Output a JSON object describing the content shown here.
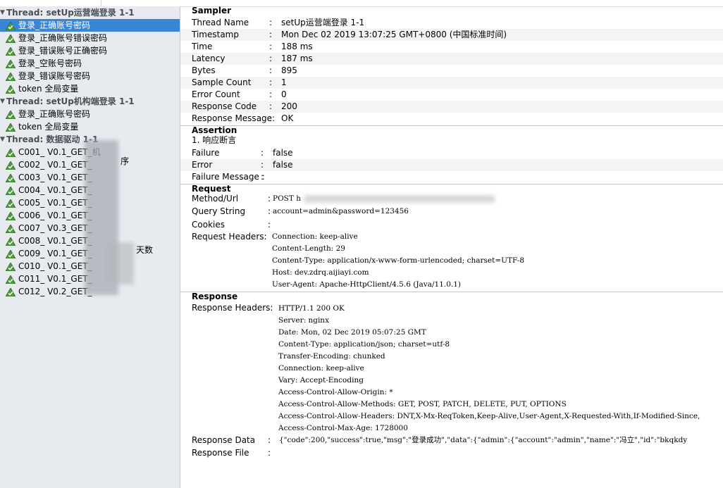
{
  "tree": {
    "items": [
      {
        "kind": "thread",
        "label": "Thread: setUp运营端登录 1-1"
      },
      {
        "kind": "sample",
        "label": "登录_正确账号密码",
        "selected": true
      },
      {
        "kind": "sample",
        "label": "登录_正确账号错误密码"
      },
      {
        "kind": "sample",
        "label": "登录_错误账号正确密码"
      },
      {
        "kind": "sample",
        "label": "登录_空账号密码"
      },
      {
        "kind": "sample",
        "label": "登录_错误账号密码"
      },
      {
        "kind": "sample",
        "label": "token 全局变量"
      },
      {
        "kind": "thread",
        "label": "Thread: setUp机构端登录 1-1"
      },
      {
        "kind": "sample",
        "label": "登录_正确账号密码"
      },
      {
        "kind": "sample",
        "label": "token 全局变量"
      },
      {
        "kind": "thread",
        "label": "Thread: 数据驱动 1-1"
      },
      {
        "kind": "sample",
        "label": "C001_ V0.1_GET_机"
      },
      {
        "kind": "sample",
        "label": "C002_ V0.1_GET_"
      },
      {
        "kind": "sample",
        "label": "C003_ V0.1_GET_"
      },
      {
        "kind": "sample",
        "label": "C004_ V0.1_GET_"
      },
      {
        "kind": "sample",
        "label": "C005_ V0.1_GET_"
      },
      {
        "kind": "sample",
        "label": "C006_ V0.1_GET_"
      },
      {
        "kind": "sample",
        "label": "C007_ V0.3_GET_"
      },
      {
        "kind": "sample",
        "label": "C008_ V0.1_GET_"
      },
      {
        "kind": "sample",
        "label": "C009_ V0.1_GET_"
      },
      {
        "kind": "sample",
        "label": "C010_ V0.1_GET_"
      },
      {
        "kind": "sample",
        "label": "C011_ V0.1_GET_"
      },
      {
        "kind": "sample",
        "label": "C012_ V0.2_GET_"
      }
    ],
    "c009_suffix": "天数",
    "c002_suffix": "序"
  },
  "sampler": {
    "title": "Sampler",
    "rows": [
      {
        "label": "Thread Name",
        "value": "setUp运营端登录 1-1"
      },
      {
        "label": "Timestamp",
        "value": "Mon Dec 02 2019 13:07:25 GMT+0800 (中国标准时间)"
      },
      {
        "label": "Time",
        "value": "188 ms"
      },
      {
        "label": "Latency",
        "value": "187 ms"
      },
      {
        "label": "Bytes",
        "value": "895"
      },
      {
        "label": "Sample Count",
        "value": "1"
      },
      {
        "label": "Error Count",
        "value": "0"
      },
      {
        "label": "Response Code",
        "value": "200"
      },
      {
        "label": "Response Message:",
        "value": "OK"
      }
    ]
  },
  "assertion": {
    "title": "Assertion",
    "name": "1. 响应断言",
    "rows": [
      {
        "label": "Failure",
        "value": "false"
      },
      {
        "label": "Error",
        "value": "false"
      },
      {
        "label": "Failure Message :",
        "value": ""
      }
    ]
  },
  "request": {
    "title": "Request",
    "method_label": "Method/Url",
    "method_value": "POST h",
    "query_label": "Query String",
    "query_value": "account=admin&password=123456",
    "cookies_label": "Cookies",
    "headers_label": "Request Headers:",
    "headers": [
      "Connection: keep-alive",
      "Content-Length: 29",
      "Content-Type: application/x-www-form-urlencoded; charset=UTF-8",
      "Host: dev.zdrq.aijiayi.com",
      "User-Agent: Apache-HttpClient/4.5.6 (Java/11.0.1)"
    ]
  },
  "response": {
    "title": "Response",
    "headers_label": "Response Headers:",
    "headers": [
      "HTTP/1.1 200 OK",
      "Server: nginx",
      "Date: Mon, 02 Dec 2019 05:07:25 GMT",
      "Content-Type: application/json; charset=utf-8",
      "Transfer-Encoding: chunked",
      "Connection: keep-alive",
      "Vary: Accept-Encoding",
      "Access-Control-Allow-Origin: *",
      "Access-Control-Allow-Methods: GET, POST, PATCH, DELETE, PUT, OPTIONS",
      "Access-Control-Allow-Headers: DNT,X-Mx-ReqToken,Keep-Alive,User-Agent,X-Requested-With,If-Modified-Since,",
      "Access-Control-Max-Age: 1728000"
    ],
    "data_label": "Response Data",
    "data_value": "{\"code\":200,\"success\":true,\"msg\":\"登录成功\",\"data\":{\"admin\":{\"account\":\"admin\",\"name\":\"冯立\",\"id\":\"bkqkdy",
    "file_label": "Response File",
    "file_value": ""
  }
}
